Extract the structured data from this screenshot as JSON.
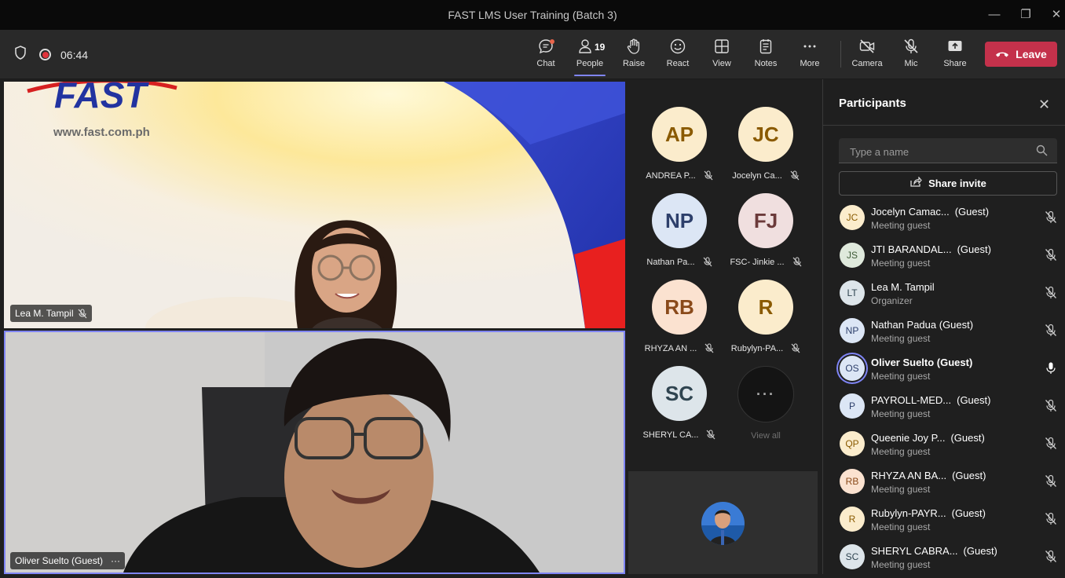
{
  "window": {
    "title": "FAST LMS User Training (Batch 3)"
  },
  "toolbar": {
    "timer": "06:44",
    "people_count": "19",
    "buttons": [
      {
        "id": "chat",
        "label": "Chat",
        "icon": "chat-icon"
      },
      {
        "id": "people",
        "label": "People",
        "icon": "people-icon"
      },
      {
        "id": "raise",
        "label": "Raise",
        "icon": "hand-icon"
      },
      {
        "id": "react",
        "label": "React",
        "icon": "smiley-icon"
      },
      {
        "id": "view",
        "label": "View",
        "icon": "grid-icon"
      },
      {
        "id": "notes",
        "label": "Notes",
        "icon": "notes-icon"
      },
      {
        "id": "more",
        "label": "More",
        "icon": "more-icon"
      },
      {
        "id": "camera",
        "label": "Camera",
        "icon": "camera-off-icon"
      },
      {
        "id": "mic",
        "label": "Mic",
        "icon": "mic-off-icon"
      },
      {
        "id": "share",
        "label": "Share",
        "icon": "share-screen-icon"
      }
    ],
    "leave_label": "Leave"
  },
  "stage": {
    "video1": {
      "logo_text": "FAST",
      "website": "www.fast.com.ph",
      "name": "Lea M. Tampil"
    },
    "video2": {
      "name": "Oliver Suelto (Guest)"
    }
  },
  "gallery": [
    {
      "initials": "AP",
      "name": "ANDREA P...",
      "bg": "#fbeccc",
      "fg": "#8a5a00"
    },
    {
      "initials": "JC",
      "name": "Jocelyn Ca...",
      "bg": "#fbeccc",
      "fg": "#8a5a00"
    },
    {
      "initials": "NP",
      "name": "Nathan Pa...",
      "bg": "#dce6f5",
      "fg": "#2d3f6b"
    },
    {
      "initials": "FJ",
      "name": "FSC- Jinkie ...",
      "bg": "#f0dfdf",
      "fg": "#6b3a3a"
    },
    {
      "initials": "RB",
      "name": "RHYZA AN ...",
      "bg": "#fbe2d0",
      "fg": "#8a4a1a"
    },
    {
      "initials": "R",
      "name": "Rubylyn-PA...",
      "bg": "#fbeccc",
      "fg": "#8a5a00"
    },
    {
      "initials": "SC",
      "name": "SHERYL CA...",
      "bg": "#dde5ea",
      "fg": "#2f4450"
    }
  ],
  "gallery_more": {
    "label": "View all",
    "glyph": "···"
  },
  "panel": {
    "title": "Participants",
    "search_placeholder": "Type a name",
    "share_invite": "Share invite",
    "participants": [
      {
        "initials": "JC",
        "name": "Jocelyn Camac...",
        "suffix": "(Guest)",
        "role": "Meeting guest",
        "bg": "#fbeccc",
        "fg": "#8a5a00",
        "speaking": false
      },
      {
        "initials": "JS",
        "name": "JTI BARANDAL...",
        "suffix": "(Guest)",
        "role": "Meeting guest",
        "bg": "#dfe9dc",
        "fg": "#3d5a36",
        "speaking": false
      },
      {
        "initials": "LT",
        "name": "Lea M. Tampil",
        "suffix": "",
        "role": "Organizer",
        "bg": "#dde5ea",
        "fg": "#2f4450",
        "speaking": false
      },
      {
        "initials": "NP",
        "name": "Nathan Padua (Guest)",
        "suffix": "",
        "role": "Meeting guest",
        "bg": "#dce6f5",
        "fg": "#2d3f6b",
        "speaking": false
      },
      {
        "initials": "OS",
        "name": "Oliver Suelto (Guest)",
        "suffix": "",
        "role": "Meeting guest",
        "bg": "#dce6f5",
        "fg": "#2d3f6b",
        "speaking": true
      },
      {
        "initials": "P",
        "name": "PAYROLL-MED...",
        "suffix": "(Guest)",
        "role": "Meeting guest",
        "bg": "#dce6f5",
        "fg": "#2d3f6b",
        "speaking": false
      },
      {
        "initials": "QP",
        "name": "Queenie Joy P...",
        "suffix": "(Guest)",
        "role": "Meeting guest",
        "bg": "#fbeccc",
        "fg": "#8a5a00",
        "speaking": false
      },
      {
        "initials": "RB",
        "name": "RHYZA AN BA...",
        "suffix": "(Guest)",
        "role": "Meeting guest",
        "bg": "#fbe2d0",
        "fg": "#8a4a1a",
        "speaking": false
      },
      {
        "initials": "R",
        "name": "Rubylyn-PAYR...",
        "suffix": "(Guest)",
        "role": "Meeting guest",
        "bg": "#fbeccc",
        "fg": "#8a5a00",
        "speaking": false
      },
      {
        "initials": "SC",
        "name": "SHERYL CABRA...",
        "suffix": "(Guest)",
        "role": "Meeting guest",
        "bg": "#dde5ea",
        "fg": "#2f4450",
        "speaking": false
      }
    ]
  }
}
